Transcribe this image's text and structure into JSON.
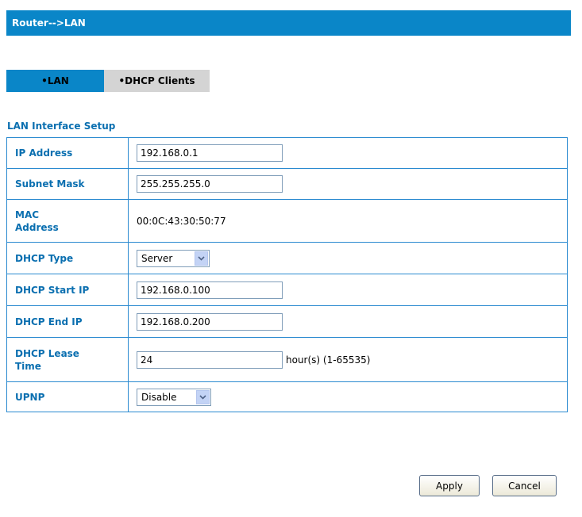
{
  "header": {
    "title": "Router-->LAN"
  },
  "tabs": [
    {
      "label": "•LAN",
      "active": true
    },
    {
      "label": "•DHCP Clients",
      "active": false
    }
  ],
  "section": {
    "title": "LAN Interface Setup"
  },
  "fields": {
    "ip_address": {
      "label": "IP Address",
      "value": "192.168.0.1"
    },
    "subnet_mask": {
      "label": "Subnet Mask",
      "value": "255.255.255.0"
    },
    "mac_address": {
      "label": "MAC Address",
      "value": "00:0C:43:30:50:77"
    },
    "dhcp_type": {
      "label": "DHCP Type",
      "value": "Server"
    },
    "dhcp_start_ip": {
      "label": "DHCP Start IP",
      "value": "192.168.0.100"
    },
    "dhcp_end_ip": {
      "label": "DHCP End IP",
      "value": "192.168.0.200"
    },
    "dhcp_lease_time": {
      "label": "DHCP Lease Time",
      "value": "24",
      "unit": "hour(s) (1-65535)"
    },
    "upnp": {
      "label": "UPNP",
      "value": "Disable"
    }
  },
  "buttons": {
    "apply": "Apply",
    "cancel": "Cancel"
  },
  "colors": {
    "accent": "#0a86c8",
    "label_text": "#0a6fb0",
    "tab_inactive": "#d4d4d4"
  }
}
